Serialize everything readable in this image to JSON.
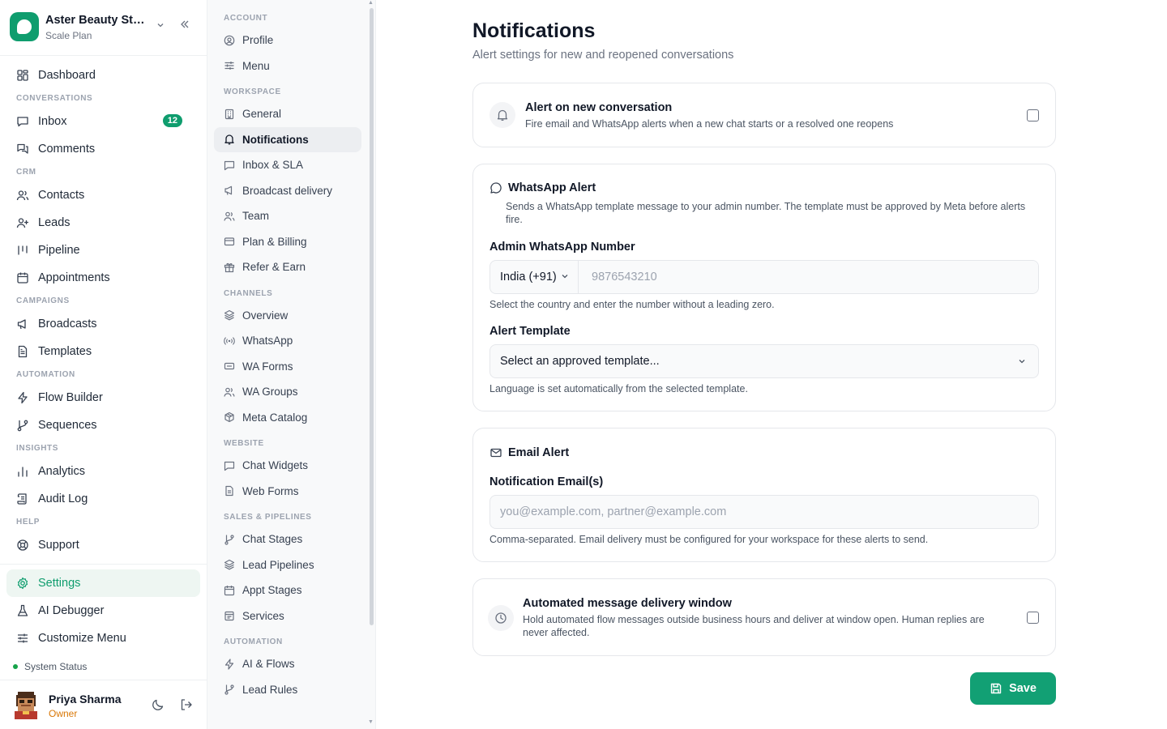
{
  "brand": {
    "name": "Aster Beauty Studio",
    "plan": "Scale Plan"
  },
  "nav": {
    "dashboard": "Dashboard",
    "sec_conversations": "CONVERSATIONS",
    "inbox": "Inbox",
    "inbox_badge": "12",
    "comments": "Comments",
    "sec_crm": "CRM",
    "contacts": "Contacts",
    "leads": "Leads",
    "pipeline": "Pipeline",
    "appointments": "Appointments",
    "sec_campaigns": "CAMPAIGNS",
    "broadcasts": "Broadcasts",
    "templates": "Templates",
    "sec_automation": "AUTOMATION",
    "flow_builder": "Flow Builder",
    "sequences": "Sequences",
    "sec_insights": "INSIGHTS",
    "analytics": "Analytics",
    "audit_log": "Audit Log",
    "sec_help": "HELP",
    "support": "Support",
    "settings": "Settings",
    "ai_debugger": "AI Debugger",
    "customize_menu": "Customize Menu"
  },
  "system_status": "System Status",
  "user": {
    "name": "Priya Sharma",
    "role": "Owner"
  },
  "settings_nav": {
    "sec_account": "ACCOUNT",
    "profile": "Profile",
    "menu": "Menu",
    "sec_workspace": "WORKSPACE",
    "general": "General",
    "notifications": "Notifications",
    "inbox_sla": "Inbox & SLA",
    "broadcast_delivery": "Broadcast delivery",
    "team": "Team",
    "plan_billing": "Plan & Billing",
    "refer_earn": "Refer & Earn",
    "sec_channels": "CHANNELS",
    "overview": "Overview",
    "whatsapp": "WhatsApp",
    "wa_forms": "WA Forms",
    "wa_groups": "WA Groups",
    "meta_catalog": "Meta Catalog",
    "sec_website": "WEBSITE",
    "chat_widgets": "Chat Widgets",
    "web_forms": "Web Forms",
    "sec_sales": "SALES & PIPELINES",
    "chat_stages": "Chat Stages",
    "lead_pipelines": "Lead Pipelines",
    "appt_stages": "Appt Stages",
    "services": "Services",
    "sec_automation": "AUTOMATION",
    "ai_flows": "AI & Flows",
    "lead_rules": "Lead Rules"
  },
  "page": {
    "title": "Notifications",
    "subtitle": "Alert settings for new and reopened conversations"
  },
  "alert_new": {
    "title": "Alert on new conversation",
    "desc": "Fire email and WhatsApp alerts when a new chat starts or a resolved one reopens",
    "checked": false
  },
  "whatsapp_alert": {
    "title": "WhatsApp Alert",
    "desc": "Sends a WhatsApp template message to your admin number. The template must be approved by Meta before alerts fire.",
    "number_label": "Admin WhatsApp Number",
    "country": "India (+91)",
    "number_placeholder": "9876543210",
    "number_hint": "Select the country and enter the number without a leading zero.",
    "template_label": "Alert Template",
    "template_value": "Select an approved template...",
    "template_hint": "Language is set automatically from the selected template."
  },
  "email_alert": {
    "title": "Email Alert",
    "label": "Notification Email(s)",
    "placeholder": "you@example.com, partner@example.com",
    "hint": "Comma-separated. Email delivery must be configured for your workspace for these alerts to send."
  },
  "delivery_window": {
    "title": "Automated message delivery window",
    "desc": "Hold automated flow messages outside business hours and deliver at window open. Human replies are never affected.",
    "checked": false
  },
  "save_label": "Save",
  "colors": {
    "accent": "#0f9d6e",
    "badge": "#0f9d6e",
    "role": "#d97706"
  }
}
